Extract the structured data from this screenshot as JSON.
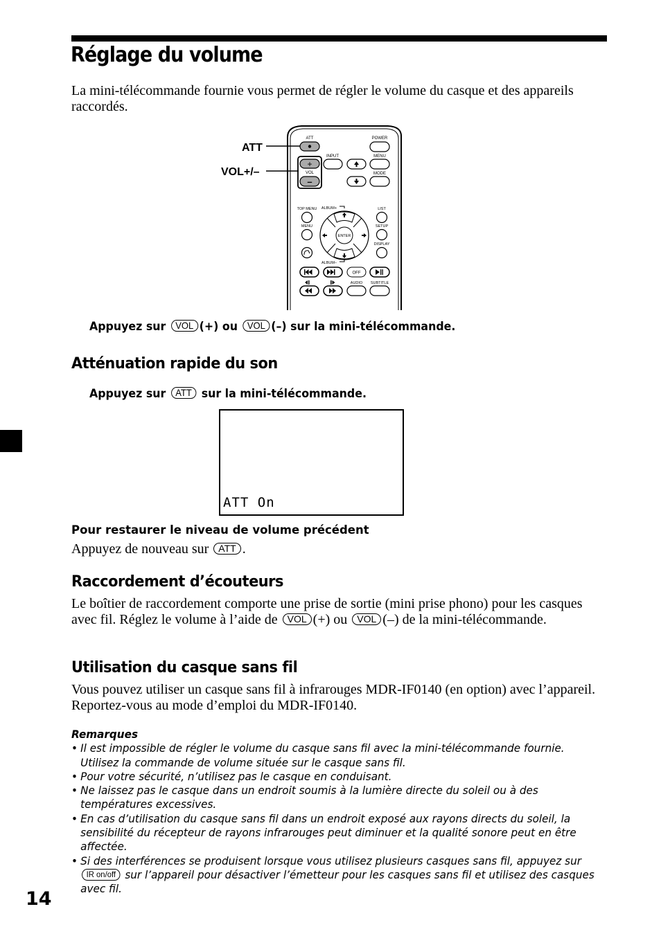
{
  "page": {
    "title": "Réglage du volume",
    "intro": "La mini-télécommande fournie vous permet de régler le volume du casque et des appareils raccordés.",
    "page_number": "14"
  },
  "remote": {
    "callouts": {
      "att": "ATT",
      "vol": "VOL+/–"
    },
    "labels": {
      "att": "ATT",
      "power": "POWER",
      "input": "INPUT",
      "menu_top": "MENU",
      "vol": "VOL",
      "mode": "MODE",
      "top_menu": "TOP MENU",
      "album_plus": "ALBUM+",
      "list": "LIST",
      "menu": "MENU",
      "setup": "SETUP",
      "enter": "ENTER",
      "display": "DISPLAY",
      "album_minus": "ALBUM–",
      "off": "OFF",
      "audio": "AUDIO",
      "subtitle": "SUBTITLE",
      "plus": "+",
      "minus": "–"
    }
  },
  "step1": {
    "pre": "Appuyez sur",
    "key1": "VOL",
    "mid": "(+) ou",
    "key2": "VOL",
    "post": "(–) sur la mini-télécommande."
  },
  "section_att": {
    "heading": "Atténuation rapide du son",
    "step": {
      "pre": "Appuyez sur",
      "key": "ATT",
      "post": "sur la mini-télécommande."
    },
    "display_text": "ATT On",
    "restore_heading": "Pour restaurer le niveau de volume précédent",
    "restore": {
      "pre": "Appuyez de nouveau sur",
      "key": "ATT",
      "post": "."
    }
  },
  "section_headphones": {
    "heading": "Raccordement d’écouteurs",
    "p_a": "Le boîtier de raccordement comporte une prise de sortie (mini prise phono) pour les casques avec fil. Réglez le volume à l’aide de",
    "key1": "VOL",
    "p_b": "(+) ou",
    "key2": "VOL",
    "p_c": "(–) de la mini-télécommande."
  },
  "section_wireless": {
    "heading": "Utilisation du casque sans fil",
    "body": "Vous pouvez utiliser un casque sans fil à infrarouges MDR-IF0140 (en option) avec l’appareil. Reportez-vous au mode d’emploi du MDR-IF0140."
  },
  "notes": {
    "heading": "Remarques",
    "items": [
      "Il est impossible de régler le volume du casque sans fil avec la mini-télécommande fournie. Utilisez la commande de volume située sur le casque sans fil.",
      "Pour votre sécurité, n’utilisez pas le casque en conduisant.",
      "Ne laissez pas le casque dans un endroit soumis à la lumière directe du soleil ou à des températures excessives.",
      "En cas d’utilisation du casque sans fil dans un endroit exposé aux rayons directs du soleil, la sensibilité du récepteur de rayons infrarouges peut diminuer et la qualité sonore peut en être affectée."
    ],
    "last": {
      "pre": "Si des interférences se produisent lorsque vous utilisez plusieurs casques sans fil, appuyez sur",
      "key": "IR on/off",
      "post": "sur l’appareil pour désactiver l’émetteur pour les casques sans fil et utilisez des casques avec fil."
    }
  }
}
